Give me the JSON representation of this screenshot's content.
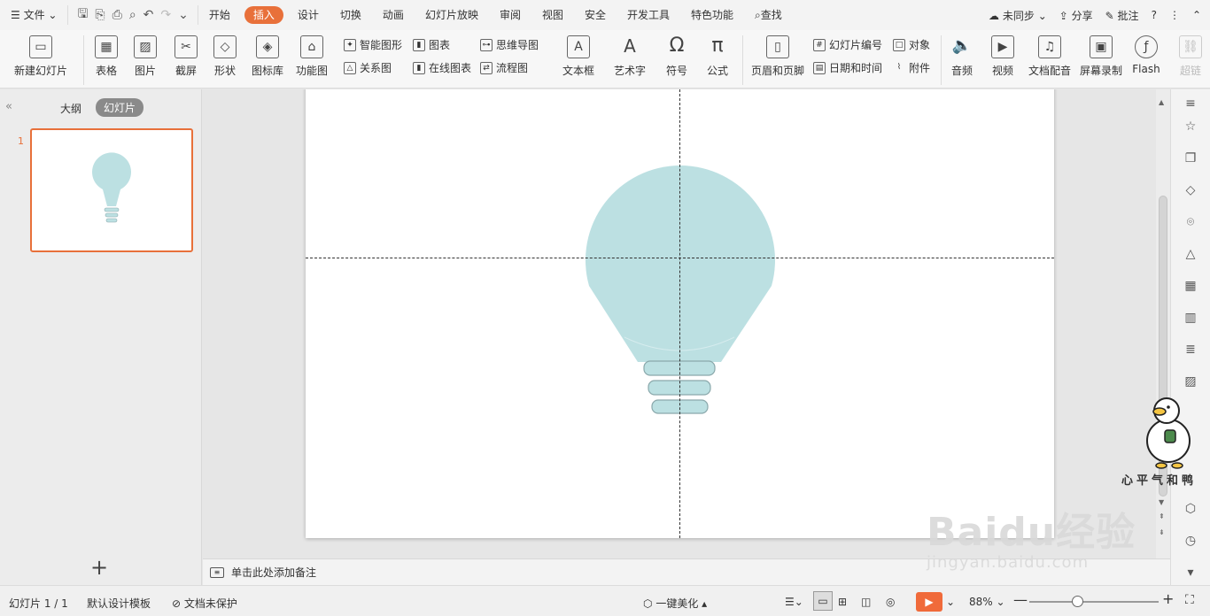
{
  "menubar": {
    "file_label": "文件",
    "tabs": [
      "开始",
      "插入",
      "设计",
      "切换",
      "动画",
      "幻灯片放映",
      "审阅",
      "视图",
      "安全",
      "开发工具",
      "特色功能"
    ],
    "active_tab": "插入",
    "search_label": "查找",
    "sync_label": "未同步",
    "share_label": "分享",
    "comment_label": "批注",
    "help_label": "?"
  },
  "ribbon": {
    "new_slide": "新建幻灯片",
    "table": "表格",
    "picture": "图片",
    "screenshot": "截屏",
    "shapes": "形状",
    "icon_library": "图标库",
    "function_chart": "功能图",
    "smart_art": "智能图形",
    "chart": "图表",
    "mind_map": "思维导图",
    "relation_chart": "关系图",
    "online_chart": "在线图表",
    "flow_chart": "流程图",
    "textbox": "文本框",
    "word_art": "艺术字",
    "symbol": "符号",
    "formula": "公式",
    "header_footer": "页眉和页脚",
    "slide_number": "幻灯片编号",
    "object": "对象",
    "date_time": "日期和时间",
    "attachment": "附件",
    "audio": "音频",
    "video": "视频",
    "doc_dubbing": "文档配音",
    "screen_record": "屏幕录制",
    "flash": "Flash",
    "hyperlink": "超链"
  },
  "left_panel": {
    "outline_tab": "大纲",
    "slides_tab": "幻灯片",
    "slide_number": "1"
  },
  "notes": {
    "placeholder": "单击此处添加备注"
  },
  "statusbar": {
    "slide_info": "幻灯片 1 / 1",
    "template": "默认设计模板",
    "protect": "文档未保护",
    "beautify": "一键美化",
    "zoom": "88%",
    "zoom_level": 0.37
  },
  "watermark": {
    "brand": "Baidu经验",
    "url": "jingyan.baidu.com",
    "duck_caption": "心平气和鸭"
  },
  "colors": {
    "accent": "#e8703a",
    "bulb_fill": "#bce0e2",
    "bulb_stroke": "#8aa8ab"
  }
}
